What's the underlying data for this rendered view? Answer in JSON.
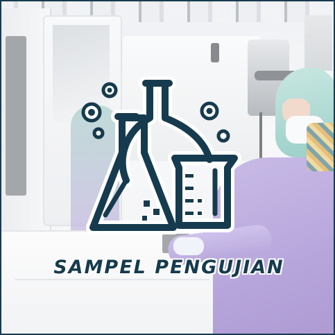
{
  "banner": {
    "title": "SAMPEL PENGUJIAN"
  },
  "icon": {
    "name": "lab-glassware-icon",
    "parts": [
      "erlenmeyer-flask-icon",
      "round-bottom-flask-icon",
      "beaker-icon",
      "bubbles-icon"
    ]
  },
  "colors": {
    "icon": "#163b4e",
    "outline": "#ffffff",
    "frame": "#163b4e"
  }
}
